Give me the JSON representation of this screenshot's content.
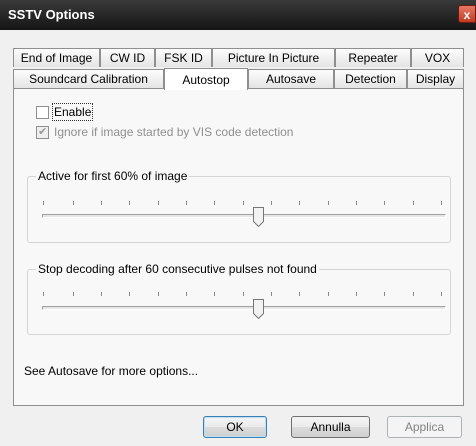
{
  "window": {
    "title": "SSTV Options",
    "close_glyph": "x"
  },
  "tabs": {
    "row1": [
      "End of Image",
      "CW ID",
      "FSK ID",
      "Picture In Picture",
      "Repeater",
      "VOX"
    ],
    "row2": [
      "Soundcard Calibration",
      "Autostop",
      "Autosave",
      "Detection",
      "Display"
    ],
    "active": "Autostop"
  },
  "autostop": {
    "enable_label": "Enable",
    "enable_checked": false,
    "ignore_label": "Ignore if image started by VIS code detection",
    "ignore_checked": true,
    "active_group": {
      "title": "Active for first 60% of image",
      "value_percent": 60
    },
    "stop_group": {
      "title": "Stop decoding after 60 consecutive pulses not found"
    },
    "footer_note": "See Autosave for more options..."
  },
  "buttons": {
    "ok": "OK",
    "cancel": "Annulla",
    "apply": "Applica"
  }
}
